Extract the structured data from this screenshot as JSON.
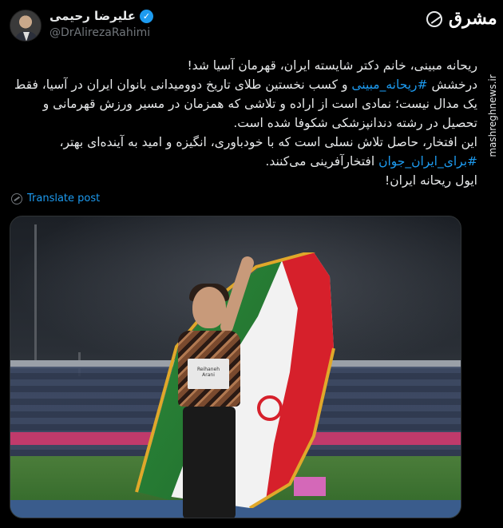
{
  "author": {
    "display_name": "علیرضا رحیمی",
    "handle": "@DrAlirezaRahimi"
  },
  "brand": {
    "logo_text": "مشرق",
    "site": "mashreghnews.ir"
  },
  "post": {
    "lines": [
      "ریحانه مبینی، خانم دکتر شایسته ایران، قهرمان آسیا شد!",
      "درخشش #ریحانه_مبینی و کسب نخستین طلای تاریخ دوومیدانی بانوان ایران در آسیا، فقط یک مدال نیست؛ نمادی است از اراده و تلاشی که همزمان در مسیر ورزش قهرمانی و تحصیل در رشته دندانپزشکی شکوفا شده است.",
      "این افتخار، حاصل تلاش نسلی است که با خودباوری، انگیزه و امید به آینده‌ای بهتر، #برای_ایران_جوان افتخارآفرینی می‌کنند.",
      "ایول ریحانه ایران!"
    ],
    "translate_label": "Translate post",
    "image": {
      "description": "Athlete holding Iranian flag in stadium",
      "bib_text": "Reihaneh Arani",
      "sponsor": "Milank"
    }
  },
  "colors": {
    "background": "#000000",
    "text": "#e7e9ea",
    "muted": "#71767b",
    "link": "#1d9bf0",
    "verified": "#1d9bf0"
  }
}
